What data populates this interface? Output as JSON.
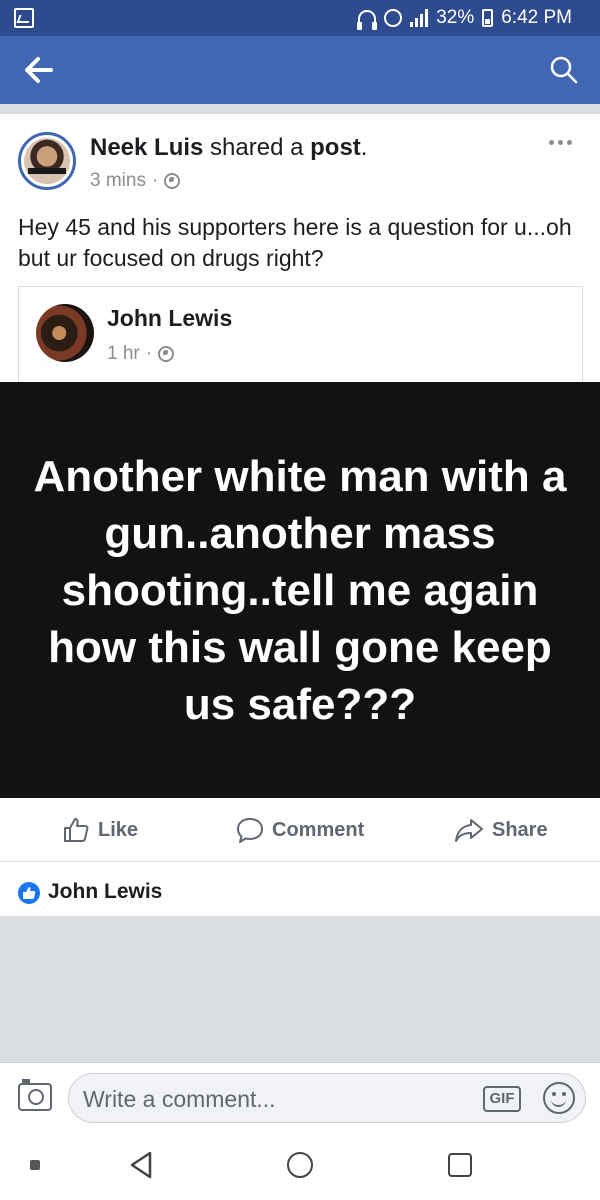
{
  "status_bar": {
    "battery": "32%",
    "time": "6:42 PM",
    "network": "LTE",
    "icons": [
      "image-icon",
      "headset-icon",
      "alarm-icon",
      "signal-icon",
      "battery-icon"
    ]
  },
  "app_bar": {
    "color": "#4267b2",
    "icons": [
      "back-arrow-icon",
      "search-icon"
    ]
  },
  "post": {
    "author": "Neek Luis",
    "action_prefix": " shared a ",
    "action_object": "post",
    "action_suffix": ".",
    "time": "3 mins",
    "separator": "·",
    "text": "Hey 45 and his supporters here is a question for u...oh but ur focused on drugs right?",
    "shared": {
      "author": "John Lewis",
      "time": "1 hr",
      "separator": "·",
      "image_text": "Another white man with a gun..another mass shooting..tell me again how this wall gone keep us safe???"
    }
  },
  "actions": {
    "like": "Like",
    "comment": "Comment",
    "share": "Share"
  },
  "reactions": {
    "name": "John Lewis"
  },
  "comment_bar": {
    "placeholder": "Write a comment...",
    "gif_label": "GIF"
  }
}
